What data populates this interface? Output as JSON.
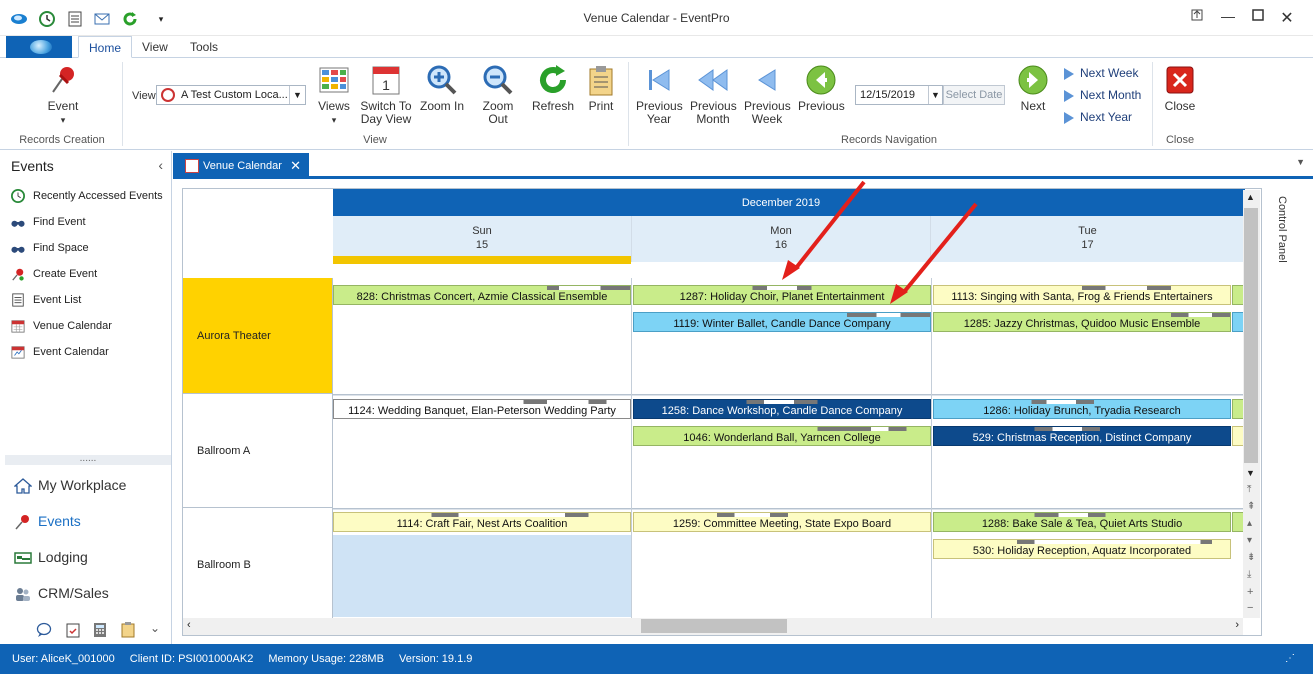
{
  "window": {
    "title": "Venue Calendar - EventPro"
  },
  "ribbon": {
    "tabs": [
      "Home",
      "View",
      "Tools"
    ],
    "event_label": "Event",
    "records_creation_group": "Records Creation",
    "view_label": "View",
    "view_selected": "A Test Custom Loca...",
    "views_label": "Views",
    "switch_line1": "Switch To",
    "switch_line2": "Day View",
    "zoom_in": "Zoom In",
    "zoom_out": "Zoom Out",
    "refresh": "Refresh",
    "print": "Print",
    "view_group": "View",
    "prev_year_1": "Previous",
    "prev_year_2": "Year",
    "prev_month_1": "Previous",
    "prev_month_2": "Month",
    "prev_week_1": "Previous",
    "prev_week_2": "Week",
    "previous": "Previous",
    "date_value": "12/15/2019",
    "select_date": "Select Date",
    "next": "Next",
    "next_week": "Next Week",
    "next_month": "Next Month",
    "next_year": "Next Year",
    "nav_group": "Records Navigation",
    "close": "Close",
    "close_group": "Close"
  },
  "sidebar": {
    "header": "Events",
    "items": [
      {
        "label": "Recently Accessed Events",
        "icon": "clock-icon"
      },
      {
        "label": "Find Event",
        "icon": "binoculars-icon"
      },
      {
        "label": "Find Space",
        "icon": "binoculars-icon"
      },
      {
        "label": "Create Event",
        "icon": "pushpin-icon"
      },
      {
        "label": "Event List",
        "icon": "list-icon"
      },
      {
        "label": "Venue Calendar",
        "icon": "calendar-icon"
      },
      {
        "label": "Event Calendar",
        "icon": "calendar-icon"
      }
    ],
    "nav": [
      "My Workplace",
      "Events",
      "Lodging",
      "CRM/Sales"
    ]
  },
  "doc_tab": {
    "label": "Venue Calendar"
  },
  "calendar": {
    "month": "December 2019",
    "days": [
      {
        "name": "Sun",
        "num": "15"
      },
      {
        "name": "Mon",
        "num": "16"
      },
      {
        "name": "Tue",
        "num": "17"
      }
    ],
    "resources": [
      "Aurora Theater",
      "Ballroom A",
      "Ballroom B"
    ],
    "events": {
      "e828": "828: Christmas Concert, Azmie Classical Ensemble",
      "e1287": "1287: Holiday Choir, Planet Entertainment",
      "e1113": "1113: Singing with Santa, Frog & Friends Entertainers",
      "e1119": "1119: Winter Ballet, Candle Dance Company",
      "e1285": "1285: Jazzy Christmas, Quidoo Music Ensemble",
      "e1124": "1124: Wedding Banquet, Elan-Peterson Wedding Party",
      "e1258": "1258: Dance Workshop, Candle Dance Company",
      "e1286": "1286: Holiday Brunch, Tryadia Research",
      "e1046": "1046: Wonderland Ball, Yarncen College",
      "e529": "529: Christmas Reception, Distinct Company",
      "e1114": "1114: Craft Fair, Nest Arts Coalition",
      "e1259": "1259: Committee Meeting, State Expo Board",
      "e1288": "1288: Bake Sale & Tea, Quiet Arts Studio",
      "e530": "530: Holiday Reception, Aquatz Incorporated"
    },
    "control_panel": "Control Panel"
  },
  "status": {
    "user": "User: AliceK_001000",
    "client": "Client ID: PSI001000AK2",
    "memory": "Memory Usage: 228MB",
    "version": "Version: 19.1.9"
  },
  "colors": {
    "accent": "#0f63b5",
    "event_green": "#c9ec8a",
    "event_yellow": "#fdfcc4",
    "event_light_blue": "#7dd3f5",
    "event_dark_blue": "#0d4a8c",
    "today_highlight": "#f2c500",
    "annotation_arrow": "#e3201b"
  }
}
